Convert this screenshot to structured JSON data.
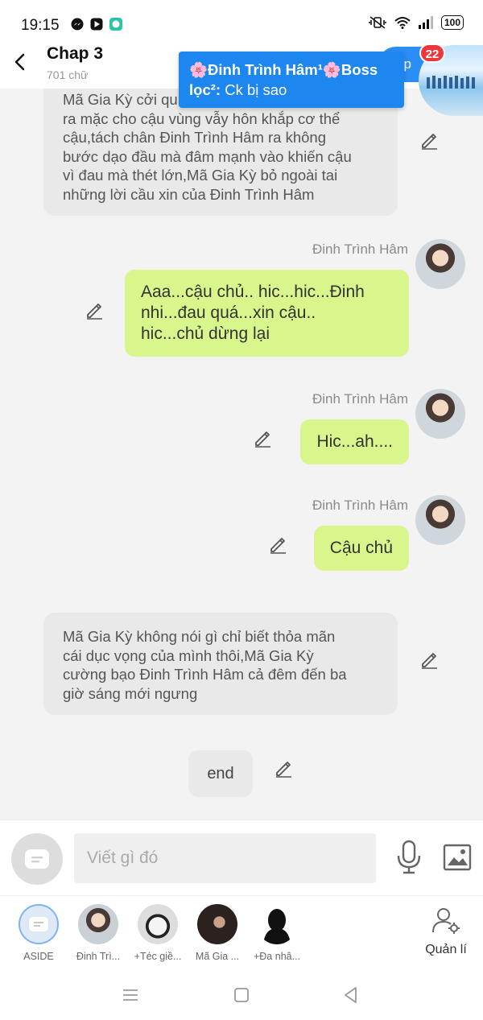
{
  "status_bar": {
    "time": "19:15",
    "battery": "100"
  },
  "header": {
    "title": "Chap 3",
    "subtitle": "701 chữ",
    "next_label": "ếp",
    "badge_count": "22"
  },
  "toast": {
    "sender": "🌸Đinh Trình Hâm¹🌸Boss lọc²:",
    "message": "Ck bị sao"
  },
  "messages": {
    "narration_1": [
      "Mã Gia Kỳ cởi qu",
      "ra mặc cho cậu vùng vẫy hôn khắp cơ thể",
      "cậu,tách chân Đinh Trình Hâm ra không",
      "bước dạo đầu mà đâm mạnh vào khiến cậu",
      "vì đau mà thét lớn,Mã Gia Kỳ bỏ ngoài tai",
      "những lời cầu xin của Đinh Trình Hâm"
    ],
    "sender": "Đinh Trình Hâm",
    "bubble_1": [
      "Aaa...cậu chủ.. hic...hic...Đinh",
      "nhi...đau quá...xin cậu..",
      "hic...chủ dừng lại"
    ],
    "bubble_2": "Hic...ah....",
    "bubble_3": "Cậu chủ",
    "narration_2": [
      "Mã Gia Kỳ không nói gì chỉ biết thỏa mãn",
      "cái dục vọng của mình thôi,Mã Gia Kỳ",
      "cường bạo Đinh Trình Hâm cả đêm đến ba",
      "giờ sáng mới ngưng"
    ],
    "end": "end"
  },
  "input": {
    "placeholder": "Viết gì đó",
    "value": ""
  },
  "characters": [
    {
      "label": "ASIDE",
      "icon": "aside-icon"
    },
    {
      "label": "Đinh Trì..."
    },
    {
      "label": "+Téc giề..."
    },
    {
      "label": "Mã Gia ..."
    },
    {
      "label": "+Đa nhâ..."
    }
  ],
  "manage_label": "Quản lí",
  "colors": {
    "accent": "#2b8ef5",
    "bubble": "#d8f68c",
    "badge": "#f0353b",
    "narration_bg": "#e9e9e9"
  }
}
